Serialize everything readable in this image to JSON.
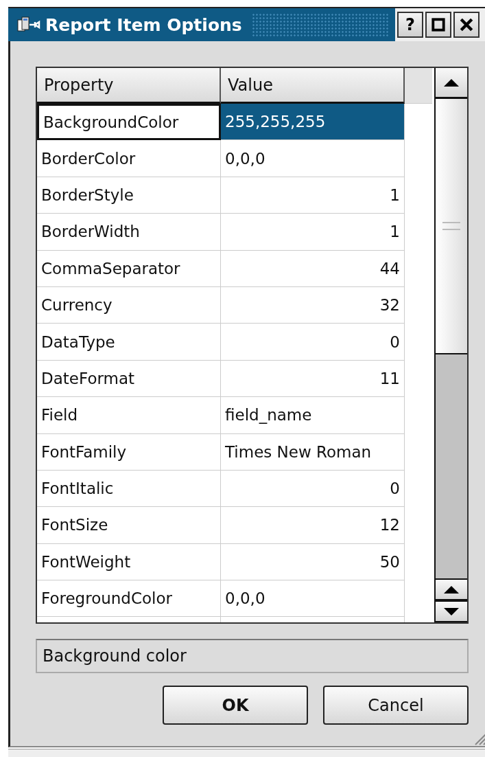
{
  "window": {
    "title": "Report Item Options"
  },
  "title_buttons": [
    {
      "kind": "help",
      "label": "?"
    },
    {
      "kind": "maximize"
    },
    {
      "kind": "close"
    }
  ],
  "table": {
    "columns": [
      "Property",
      "Value"
    ],
    "rows": [
      {
        "property": "BackgroundColor",
        "value": "255,255,255",
        "kind": "text",
        "selected": true
      },
      {
        "property": "BorderColor",
        "value": "0,0,0",
        "kind": "text",
        "selected": false
      },
      {
        "property": "BorderStyle",
        "value": "1",
        "kind": "number",
        "selected": false
      },
      {
        "property": "BorderWidth",
        "value": "1",
        "kind": "number",
        "selected": false
      },
      {
        "property": "CommaSeparator",
        "value": "44",
        "kind": "number",
        "selected": false
      },
      {
        "property": "Currency",
        "value": "32",
        "kind": "number",
        "selected": false
      },
      {
        "property": "DataType",
        "value": "0",
        "kind": "number",
        "selected": false
      },
      {
        "property": "DateFormat",
        "value": "11",
        "kind": "number",
        "selected": false
      },
      {
        "property": "Field",
        "value": "field_name",
        "kind": "text",
        "selected": false
      },
      {
        "property": "FontFamily",
        "value": "Times New Roman",
        "kind": "text",
        "selected": false
      },
      {
        "property": "FontItalic",
        "value": "0",
        "kind": "number",
        "selected": false
      },
      {
        "property": "FontSize",
        "value": "12",
        "kind": "number",
        "selected": false
      },
      {
        "property": "FontWeight",
        "value": "50",
        "kind": "number",
        "selected": false
      },
      {
        "property": "ForegroundColor",
        "value": "0,0,0",
        "kind": "text",
        "selected": false
      }
    ]
  },
  "status": "Background color",
  "buttons": [
    {
      "label": "OK",
      "default": true
    },
    {
      "label": "Cancel",
      "default": false
    }
  ]
}
